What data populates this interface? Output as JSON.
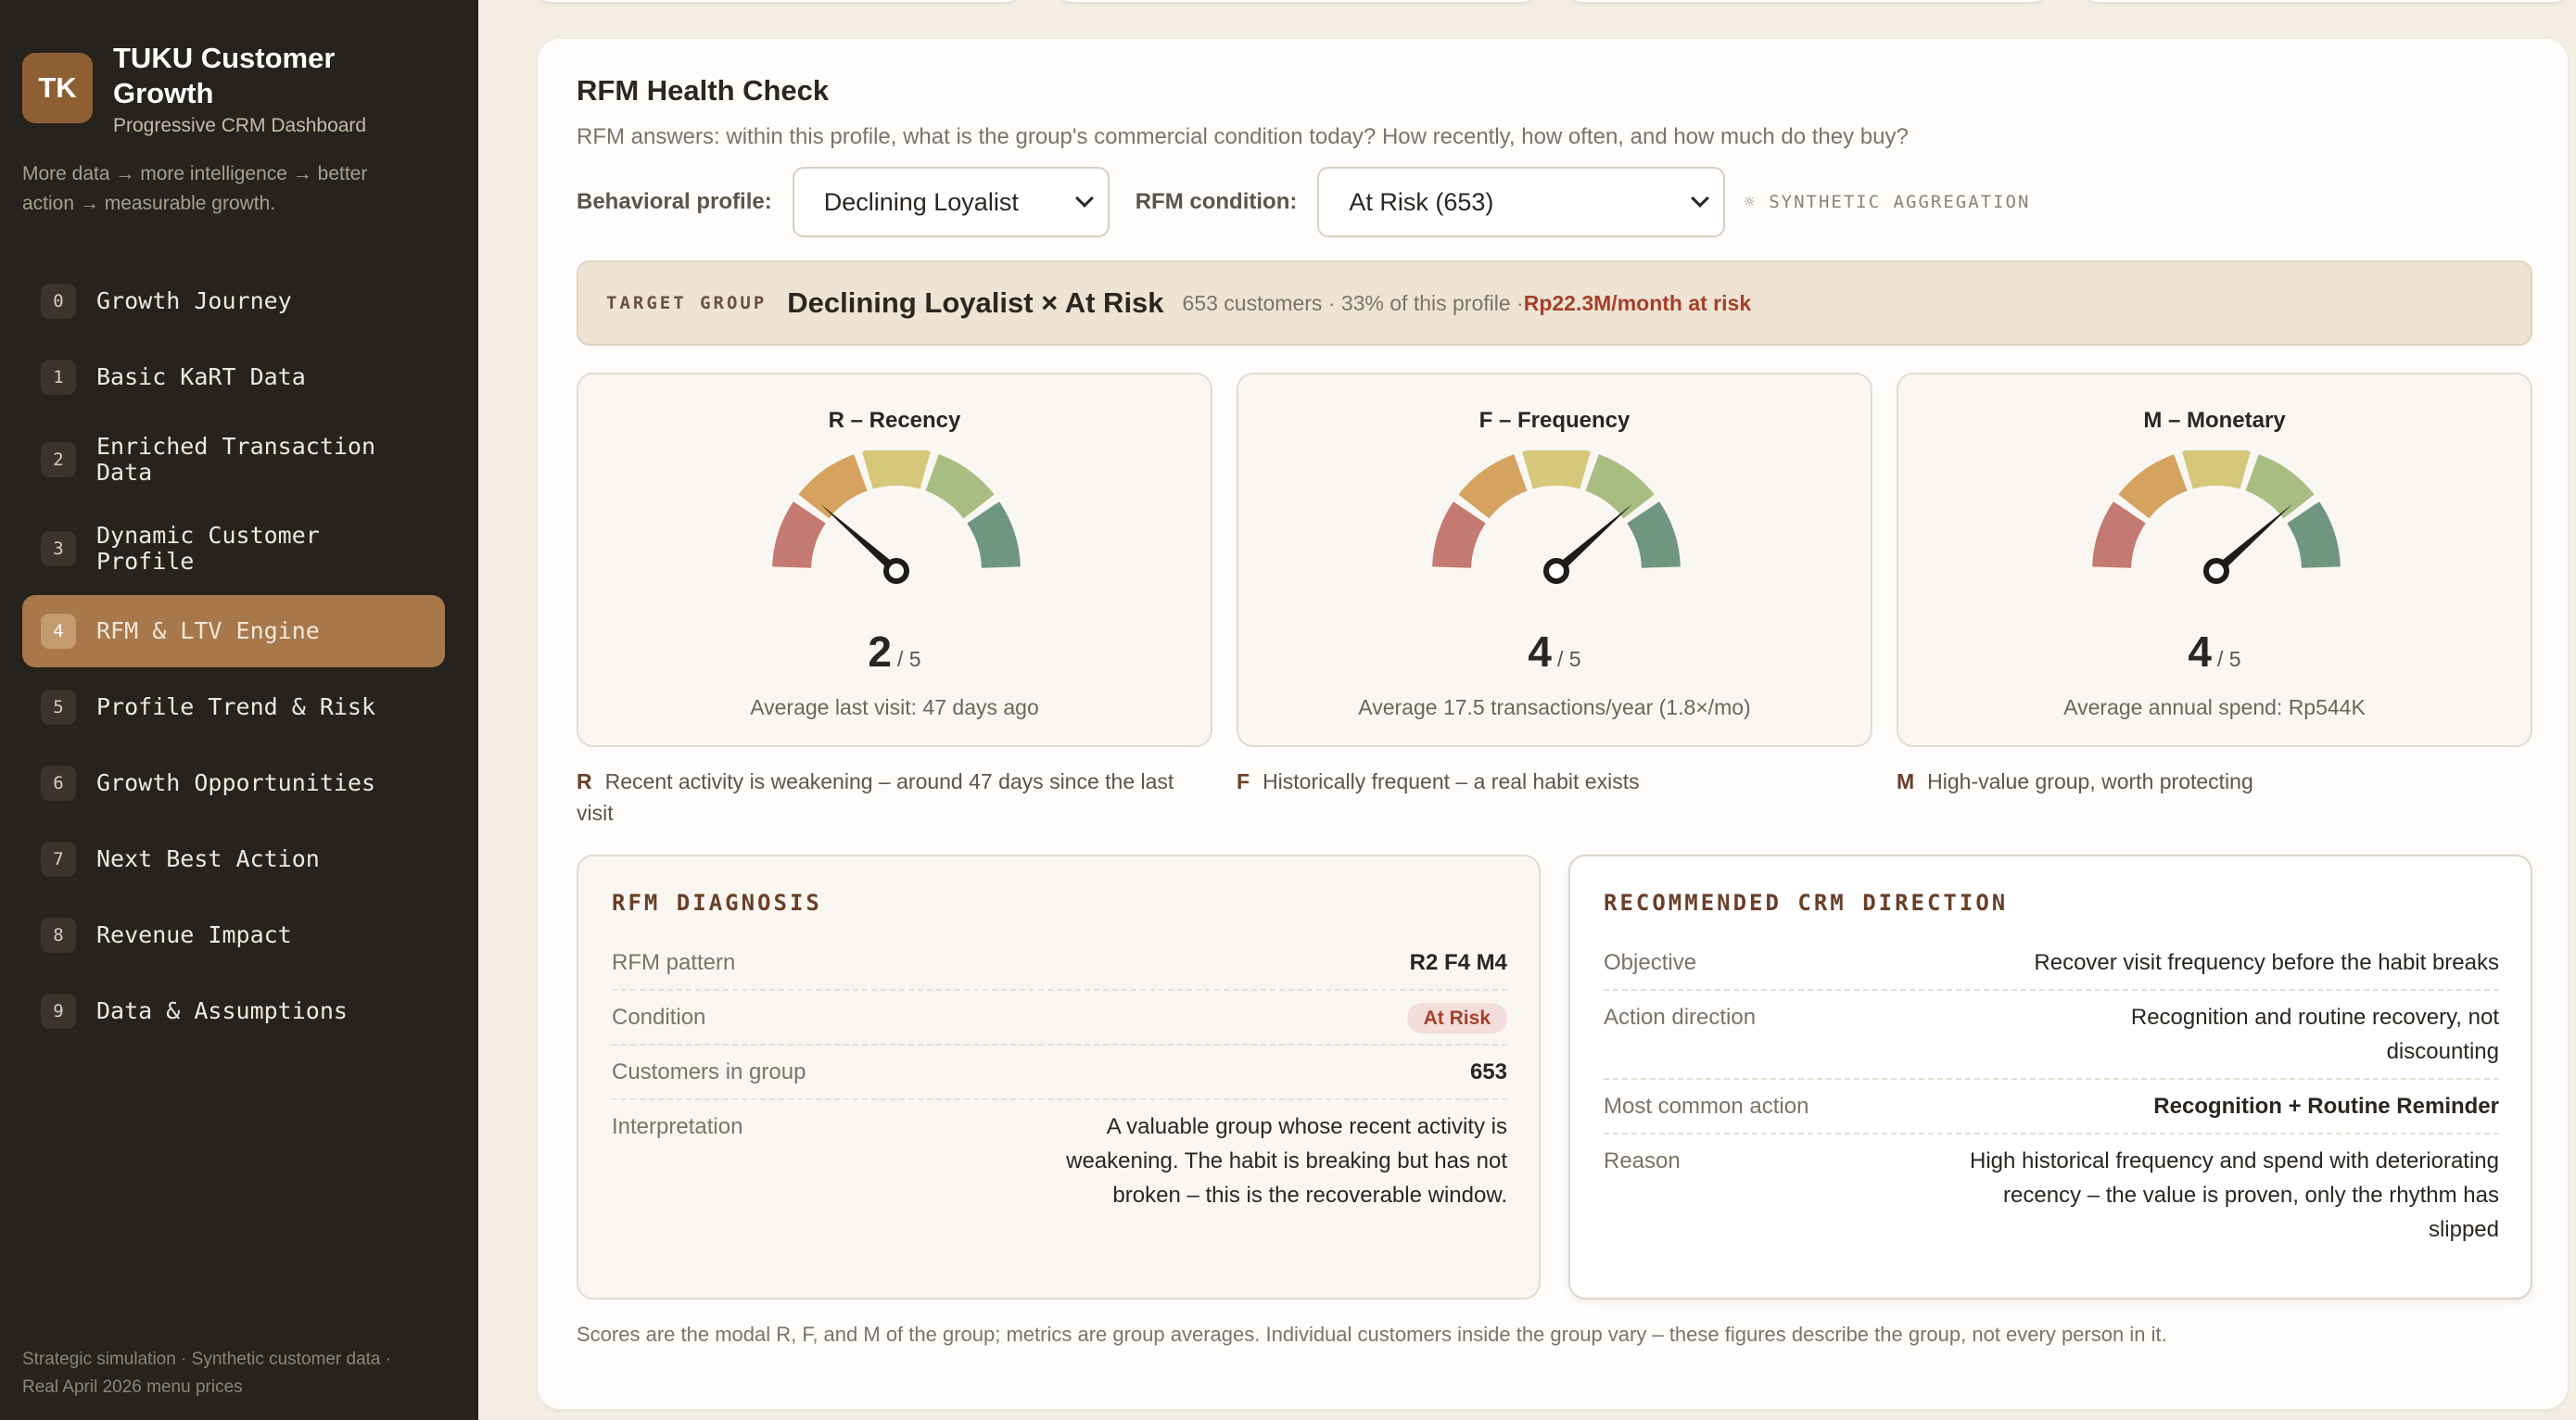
{
  "brand": {
    "logo": "TK",
    "title": "TUKU Customer Growth",
    "subtitle": "Progressive CRM Dashboard",
    "tagline": "More data → more intelligence → better action → measurable growth."
  },
  "nav": [
    {
      "num": "0",
      "label": "Growth Journey"
    },
    {
      "num": "1",
      "label": "Basic KaRT Data"
    },
    {
      "num": "2",
      "label": "Enriched Transaction Data"
    },
    {
      "num": "3",
      "label": "Dynamic Customer Profile"
    },
    {
      "num": "4",
      "label": "RFM & LTV Engine"
    },
    {
      "num": "5",
      "label": "Profile Trend & Risk"
    },
    {
      "num": "6",
      "label": "Growth Opportunities"
    },
    {
      "num": "7",
      "label": "Next Best Action"
    },
    {
      "num": "8",
      "label": "Revenue Impact"
    },
    {
      "num": "9",
      "label": "Data & Assumptions"
    }
  ],
  "sidebar_footer": "Strategic simulation · Synthetic customer data · Real April 2026 menu prices",
  "header": {
    "title": "RFM Health Check",
    "subtitle": "RFM answers: within this profile, what is the group's commercial condition today? How recently, how often, and how much do they buy?"
  },
  "filters": {
    "profile_label": "Behavioral profile:",
    "profile_value": "Declining Loyalist",
    "condition_label": "RFM condition:",
    "condition_value": "At Risk (653)",
    "synthetic_label": "☼ SYNTHETIC AGGREGATION"
  },
  "target": {
    "tag": "TARGET GROUP",
    "name": "Declining Loyalist × At Risk",
    "meta": "653 customers · 33% of this profile · ",
    "risk": "Rp22.3M/month at risk"
  },
  "gauges": [
    {
      "title": "R – Recency",
      "score": 2,
      "score_text": "2",
      "denominator": "/ 5",
      "note": "Average last visit: 47 days ago"
    },
    {
      "title": "F – Frequency",
      "score": 4,
      "score_text": "4",
      "denominator": "/ 5",
      "note": "Average 17.5 transactions/year (1.8×/mo)"
    },
    {
      "title": "M – Monetary",
      "score": 4,
      "score_text": "4",
      "denominator": "/ 5",
      "note": "Average annual spend: Rp544K"
    }
  ],
  "gauge_colors": [
    "#c47a72",
    "#d5a35f",
    "#d6c77a",
    "#a7bd82",
    "#6f9680"
  ],
  "blurbs": [
    {
      "key": "R",
      "text": "Recent activity is weakening – around 47 days since the last visit"
    },
    {
      "key": "F",
      "text": "Historically frequent – a real habit exists"
    },
    {
      "key": "M",
      "text": "High-value group, worth protecting"
    }
  ],
  "diagnosis": {
    "title": "RFM DIAGNOSIS",
    "rows": [
      {
        "k": "RFM pattern",
        "v": "R2 F4 M4"
      },
      {
        "k": "Condition",
        "v": "At Risk"
      },
      {
        "k": "Customers in group",
        "v": "653"
      },
      {
        "k": "Interpretation",
        "v": "A valuable group whose recent activity is weakening. The habit is breaking but has not broken – this is the recoverable window."
      }
    ]
  },
  "direction": {
    "title": "RECOMMENDED CRM DIRECTION",
    "rows": [
      {
        "k": "Objective",
        "v": "Recover visit frequency before the habit breaks"
      },
      {
        "k": "Action direction",
        "v": "Recognition and routine recovery, not discounting"
      },
      {
        "k": "Most common action",
        "v": "Recognition + Routine Reminder"
      },
      {
        "k": "Reason",
        "v": "High historical frequency and spend with deteriorating recency – the value is proven, only the rhythm has slipped"
      }
    ]
  },
  "footnote": "Scores are the modal R, F, and M of the group; metrics are group averages. Individual customers inside the group vary – these figures describe the group, not every person in it."
}
